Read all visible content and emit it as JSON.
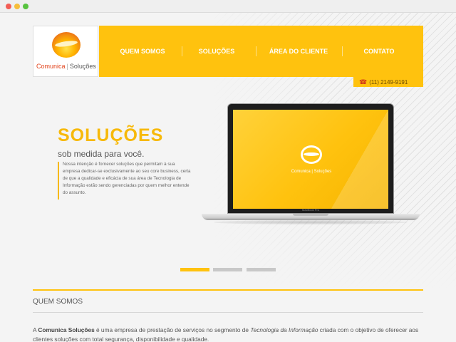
{
  "browser": {
    "buttons": [
      "close",
      "minimize",
      "maximize"
    ]
  },
  "header": {
    "logo": {
      "brand": "Comunica",
      "separator": "|",
      "sub": "Soluções"
    },
    "nav": [
      {
        "label": "QUEM SOMOS"
      },
      {
        "label": "SOLUÇÕES"
      },
      {
        "label": "ÁREA DO CLIENTE"
      },
      {
        "label": "CONTATO"
      }
    ],
    "phone": "(11) 2149-9191",
    "phone_icon": "phone-icon",
    "accent_color": "#ffc20e"
  },
  "hero": {
    "title": "SOLUÇÕES",
    "subtitle": "sob medida para você.",
    "body": "Nossa intenção é fornecer soluções que permitam à sua empresa dedicar-se exclusivamente ao seu core business, certa de que a qualidade e eficácia de sua área de Tecnologia de Informação estão sendo gerenciadas por quem melhor entende do assunto.",
    "laptop": {
      "screen_brand": "Comunica",
      "screen_sub": "Soluções",
      "model_label": "MacBook Pro"
    },
    "slides": {
      "count": 3,
      "active_index": 0
    }
  },
  "about": {
    "title": "QUEM SOMOS",
    "body_prefix": "A ",
    "body_brand": "Comunica Soluções",
    "body_mid": " é uma empresa de prestação de serviços no segmento de ",
    "body_italic": "Tecnologia da Informação",
    "body_suffix": " criada com o objetivo de oferecer aos clientes soluções com total segurança, disponibilidade e qualidade."
  }
}
